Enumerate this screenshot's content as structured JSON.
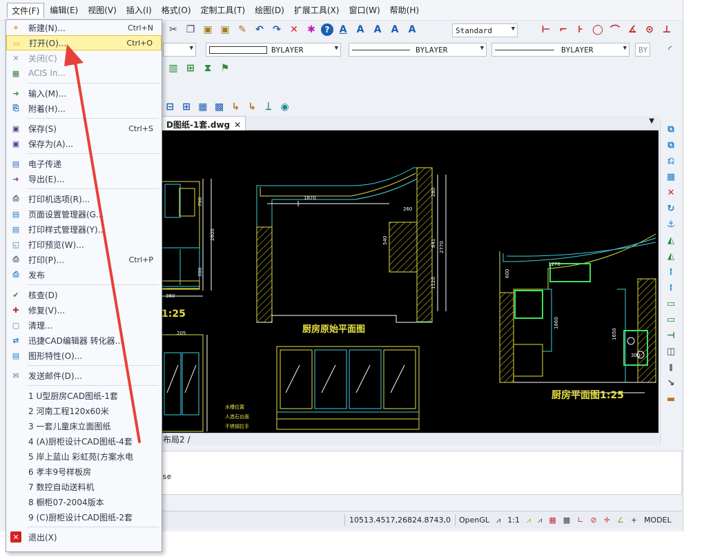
{
  "menubar": {
    "items": [
      "文件(F)",
      "编辑(E)",
      "视图(V)",
      "插入(I)",
      "格式(O)",
      "定制工具(T)",
      "绘图(D)",
      "扩展工具(X)",
      "窗口(W)",
      "帮助(H)"
    ]
  },
  "toolbar": {
    "text_style": "Standard",
    "color_combo": "BYLAYER",
    "linetype_combo": "BYLAYER",
    "lineweight_combo": "BYLAYER",
    "plot_style": "BY"
  },
  "document": {
    "tab_label": "D图纸-1套.dwg",
    "tab_close": "✕",
    "layout_tab": "布局2",
    "command_text": "se"
  },
  "status": {
    "coords": "10513.4517,26824.8743,0",
    "opengl": "OpenGL",
    "scale": "1:1",
    "model": "MODEL"
  },
  "file_menu": {
    "groups": [
      [
        {
          "label": "新建(N)...",
          "shortcut": "Ctrl+N",
          "icon": "new-file-icon",
          "color": "#f0a020",
          "glyph": "✦"
        },
        {
          "label": "打开(O)...",
          "shortcut": "Ctrl+O",
          "icon": "open-folder-icon",
          "color": "#e8a317",
          "glyph": "▭",
          "highlight": true
        },
        {
          "label": "关闭(C)",
          "shortcut": "",
          "icon": "close-doc-icon",
          "color": "#8a94a3",
          "glyph": "✕",
          "disabled": true
        },
        {
          "label": "ACIS In...",
          "shortcut": "",
          "icon": "acis-import-icon",
          "color": "#3a7d3a",
          "glyph": "▦",
          "disabled": true
        }
      ],
      [
        {
          "label": "输入(M)...",
          "shortcut": "",
          "icon": "import-icon",
          "color": "#2a8a3a",
          "glyph": "➔"
        },
        {
          "label": "附着(H)...",
          "shortcut": "",
          "icon": "attach-icon",
          "color": "#2a6ab0",
          "glyph": "⎘"
        }
      ],
      [
        {
          "label": "保存(S)",
          "shortcut": "Ctrl+S",
          "icon": "save-icon",
          "color": "#5a3a9a",
          "glyph": "▣"
        },
        {
          "label": "保存为(A)...",
          "shortcut": "",
          "icon": "save-as-icon",
          "color": "#5a3a9a",
          "glyph": "▣"
        }
      ],
      [
        {
          "label": "电子传递",
          "shortcut": "",
          "icon": "etransmit-icon",
          "color": "#3a6ab0",
          "glyph": "▤"
        },
        {
          "label": "导出(E)...",
          "shortcut": "",
          "icon": "export-icon",
          "color": "#8a3aa0",
          "glyph": "➜"
        }
      ],
      [
        {
          "label": "打印机选项(R)...",
          "shortcut": "",
          "icon": "printer-options-icon",
          "color": "#4a5a7a",
          "glyph": "⎙"
        },
        {
          "label": "页面设置管理器(G...",
          "shortcut": "",
          "icon": "page-setup-icon",
          "color": "#2a7ac0",
          "glyph": "▤"
        },
        {
          "label": "打印样式管理器(Y)...",
          "shortcut": "",
          "icon": "plot-style-icon",
          "color": "#2a7ac0",
          "glyph": "▤"
        },
        {
          "label": "打印预览(W)...",
          "shortcut": "",
          "icon": "print-preview-icon",
          "color": "#2a7ac0",
          "glyph": "◱"
        },
        {
          "label": "打印(P)...",
          "shortcut": "Ctrl+P",
          "icon": "print-icon",
          "color": "#4a5a7a",
          "glyph": "⎙"
        },
        {
          "label": "发布",
          "shortcut": "",
          "icon": "publish-icon",
          "color": "#2a7ac0",
          "glyph": "⎙"
        }
      ],
      [
        {
          "label": "核查(D)",
          "shortcut": "",
          "icon": "audit-icon",
          "color": "#2a8a3a",
          "glyph": "✔"
        },
        {
          "label": "修复(V)...",
          "shortcut": "",
          "icon": "recover-icon",
          "color": "#c03030",
          "glyph": "✚"
        },
        {
          "label": "清理...",
          "shortcut": "",
          "icon": "purge-icon",
          "color": "#6a7a8a",
          "glyph": "▢"
        },
        {
          "label": "迅捷CAD编辑器 转化器...",
          "shortcut": "",
          "icon": "converter-icon",
          "color": "#2a7ac0",
          "glyph": "⇄"
        },
        {
          "label": "图形特性(O)...",
          "shortcut": "",
          "icon": "drawing-properties-icon",
          "color": "#2a7ac0",
          "glyph": "▤"
        }
      ],
      [
        {
          "label": "发送邮件(D)...",
          "shortcut": "",
          "icon": "send-mail-icon",
          "color": "#6a7a8a",
          "glyph": "✉"
        }
      ]
    ],
    "recent": [
      "1 U型厨房CAD图纸-1套",
      "2 河南工程120x60米",
      "3 一套儿童床立面图纸",
      "4 (A)厨柜设计CAD图纸-4套",
      "5 岸上蓝山 彩虹苑(方案水电",
      "6 孝丰9号样板房",
      "7 数控自动送料机",
      "8 橱柜07-2004版本",
      "9 (C)厨柜设计CAD图纸-2套"
    ],
    "exit": "退出(X)"
  },
  "drawing": {
    "title_left": "厨房原始平面图",
    "title_right": "厨房平面图1:25",
    "scale_left": "1:25",
    "labels": [
      "1870",
      "260",
      "280",
      "540",
      "641",
      "2770",
      "1120",
      "1270",
      "1660",
      "1650",
      "300",
      "600",
      "700",
      "2600",
      "300",
      "360",
      "205"
    ],
    "notes": [
      "水槽位置",
      "人造石台面",
      "不锈钢拉手"
    ]
  },
  "colors": {
    "highlight": "#fff3a8",
    "arrow": "#e8403a",
    "canvas": "#000000"
  }
}
